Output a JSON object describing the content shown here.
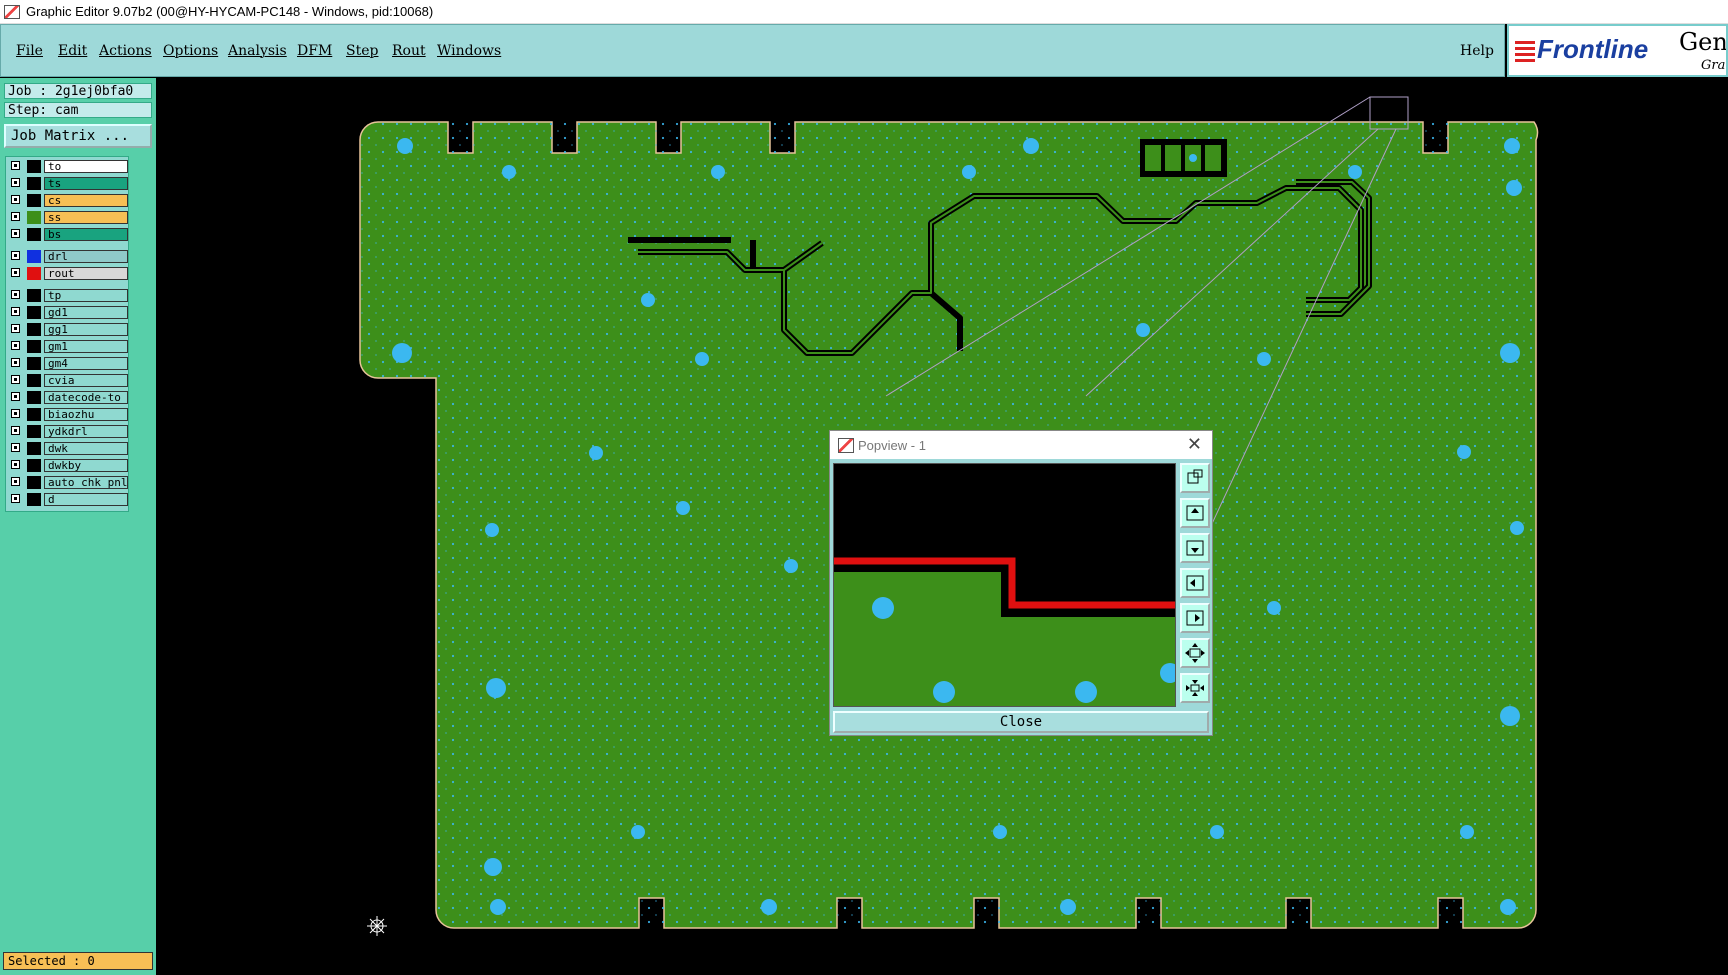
{
  "window": {
    "title": "Graphic Editor 9.07b2 (00@HY-HYCAM-PC148 - Windows, pid:10068)"
  },
  "menu": {
    "items": [
      "File",
      "Edit",
      "Actions",
      "Options",
      "Analysis",
      "DFM",
      "Step",
      "Rout",
      "Windows"
    ],
    "help": "Help"
  },
  "logo": {
    "brand": "Frontline",
    "product": "Gene",
    "sub": "Grap"
  },
  "job": {
    "label": "Job : 2g1ej0bfa0",
    "step": "Step: cam",
    "matrix_button": "Job Matrix ..."
  },
  "layers": [
    {
      "name": "to",
      "color": "#ffffff",
      "swatch": "#000000"
    },
    {
      "name": "ts",
      "color": "#19a37f",
      "swatch": "#000000"
    },
    {
      "name": "cs",
      "color": "#f7bf55",
      "swatch": "#000000"
    },
    {
      "name": "ss",
      "color": "#f7bf55",
      "swatch": "#3d8f1a"
    },
    {
      "name": "bs",
      "color": "#19a37f",
      "swatch": "#000000"
    },
    {
      "name": "drl",
      "color": "#8fc9c9",
      "swatch": "#1030e0"
    },
    {
      "name": "rout",
      "color": "#d8d8d8",
      "swatch": "#e01010"
    },
    {
      "name": "tp",
      "color": "#8fd9d0",
      "swatch": "#000000"
    },
    {
      "name": "gd1",
      "color": "#8fd9d0",
      "swatch": "#000000"
    },
    {
      "name": "gg1",
      "color": "#8fd9d0",
      "swatch": "#000000"
    },
    {
      "name": "gm1",
      "color": "#8fd9d0",
      "swatch": "#000000"
    },
    {
      "name": "gm4",
      "color": "#8fd9d0",
      "swatch": "#000000"
    },
    {
      "name": "cvia",
      "color": "#8fd9d0",
      "swatch": "#000000"
    },
    {
      "name": "datecode-to",
      "color": "#8fd9d0",
      "swatch": "#000000"
    },
    {
      "name": "biaozhu",
      "color": "#8fd9d0",
      "swatch": "#000000"
    },
    {
      "name": "ydkdrl",
      "color": "#8fd9d0",
      "swatch": "#000000"
    },
    {
      "name": "dwk",
      "color": "#8fd9d0",
      "swatch": "#000000"
    },
    {
      "name": "dwkby",
      "color": "#8fd9d0",
      "swatch": "#000000"
    },
    {
      "name": "auto_chk_pnl",
      "color": "#8fd9d0",
      "swatch": "#000000"
    },
    {
      "name": "d",
      "color": "#8fd9d0",
      "swatch": "#000000"
    }
  ],
  "status": {
    "selected": "Selected : 0"
  },
  "popview": {
    "title": "Popview - 1",
    "close_label": "Close"
  },
  "colors": {
    "board": "#3d8f1a",
    "pad": "#3bb8f0",
    "trace": "#e01010",
    "panel": "#57cfa9",
    "menubar": "#9ed9d9"
  }
}
